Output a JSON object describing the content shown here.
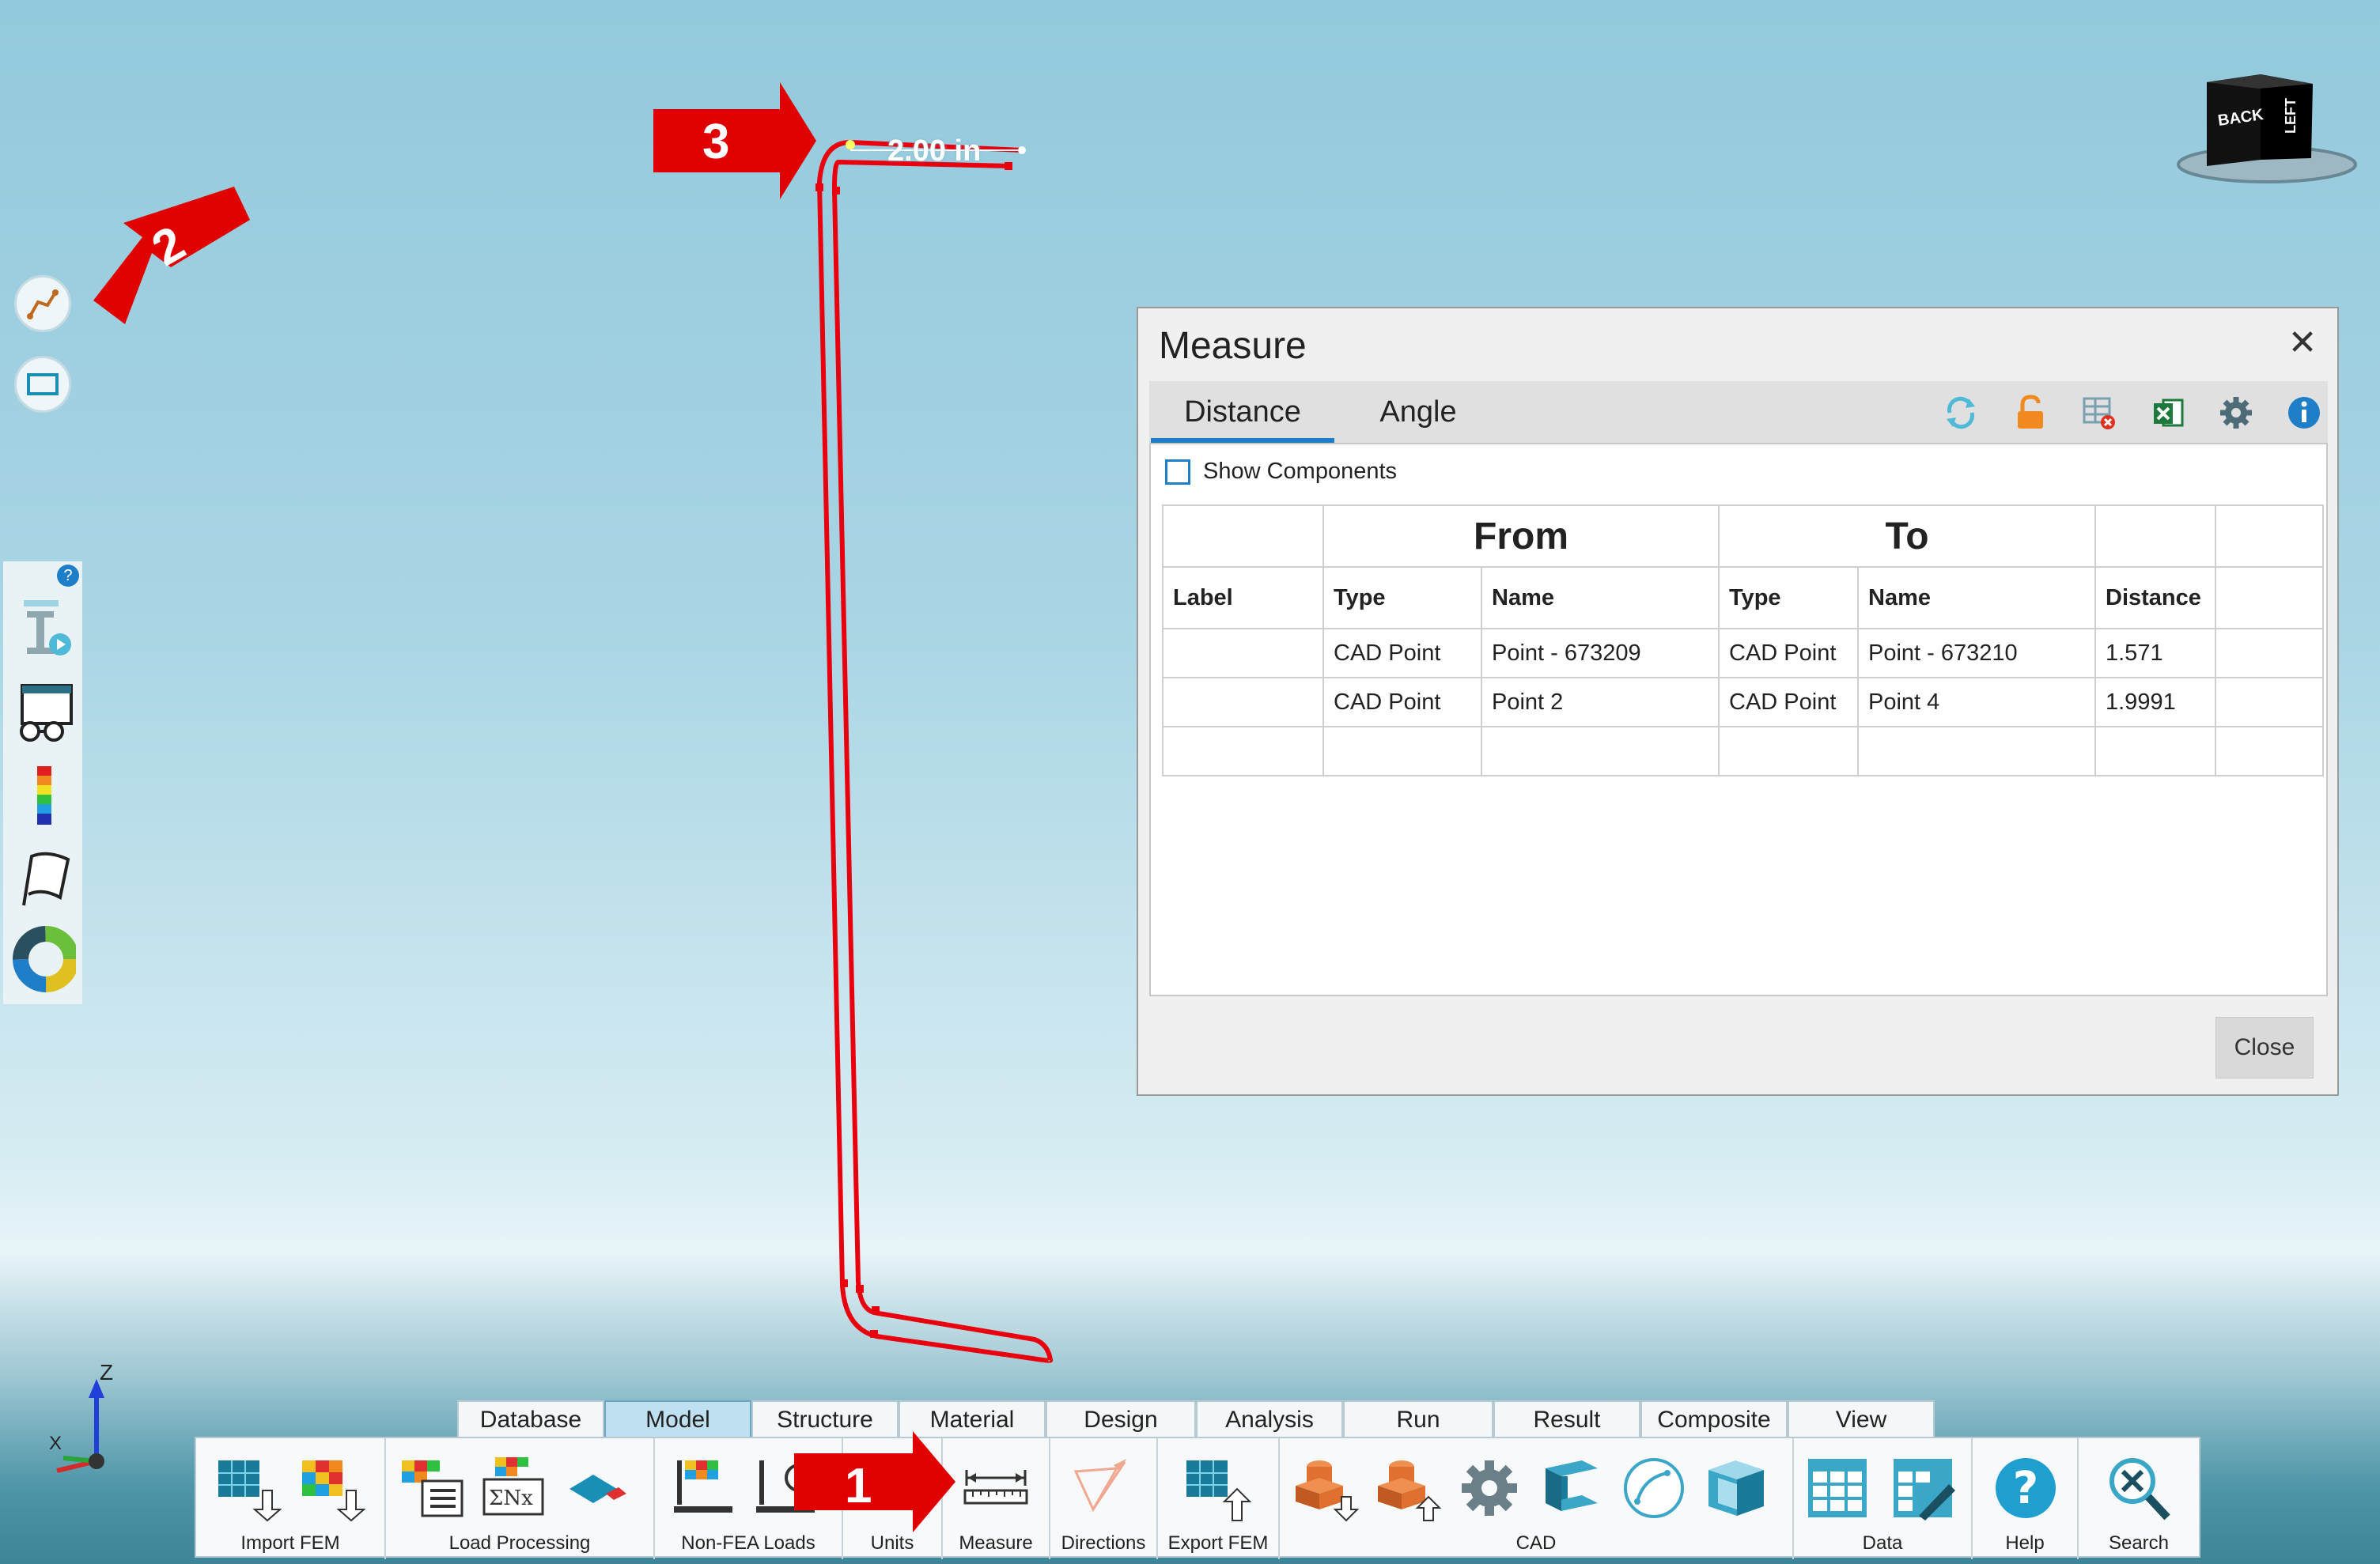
{
  "viewport": {
    "dimension_label": "2.00 in",
    "view_cube": {
      "face_back": "BACK",
      "face_left": "LEFT"
    },
    "axis": {
      "z_label": "Z",
      "x_label": "X"
    }
  },
  "annotations": {
    "arrow1": "1",
    "arrow2": "2",
    "arrow3": "3"
  },
  "left_tools": {
    "round_buttons": [
      "polyline-measure-icon",
      "rectangle-select-icon"
    ],
    "side_items": [
      "section-cut-icon",
      "view-glasses-icon",
      "color-legend-icon",
      "flag-icon",
      "color-wheel-icon"
    ],
    "help_badge": "?"
  },
  "dialog": {
    "title": "Measure",
    "close_glyph": "✕",
    "tabs": [
      {
        "label": "Distance"
      },
      {
        "label": "Angle"
      }
    ],
    "toolbar_icons": [
      "refresh-icon",
      "lock-icon",
      "delete-table-icon",
      "excel-icon",
      "settings-icon",
      "info-icon"
    ],
    "show_components_label": "Show Components",
    "table": {
      "group_headers": {
        "from": "From",
        "to": "To"
      },
      "columns": [
        "Label",
        "Type",
        "Name",
        "Type",
        "Name",
        "Distance"
      ],
      "rows": [
        {
          "label": "",
          "from_type": "CAD Point",
          "from_name": "Point - 673209",
          "to_type": "CAD Point",
          "to_name": "Point - 673210",
          "distance": "1.571"
        },
        {
          "label": "",
          "from_type": "CAD Point",
          "from_name": "Point 2",
          "to_type": "CAD Point",
          "to_name": "Point 4",
          "distance": "1.9991"
        }
      ]
    },
    "close_button": "Close"
  },
  "ribbon": {
    "tabs": [
      "Database",
      "Model",
      "Structure",
      "Material",
      "Design",
      "Analysis",
      "Run",
      "Result",
      "Composite",
      "View"
    ],
    "active_tab": "Model",
    "groups": {
      "import_fem": "Import FEM",
      "load_processing": "Load Processing",
      "non_fea_loads": "Non-FEA Loads",
      "units": "Units",
      "measure": "Measure",
      "directions": "Directions",
      "export_fem": "Export FEM",
      "cad": "CAD",
      "data": "Data",
      "help": "Help",
      "search": "Search"
    }
  },
  "colors": {
    "accent": "#1e7fc8",
    "annotation_red": "#e00000",
    "profile_red": "#e8000e"
  }
}
